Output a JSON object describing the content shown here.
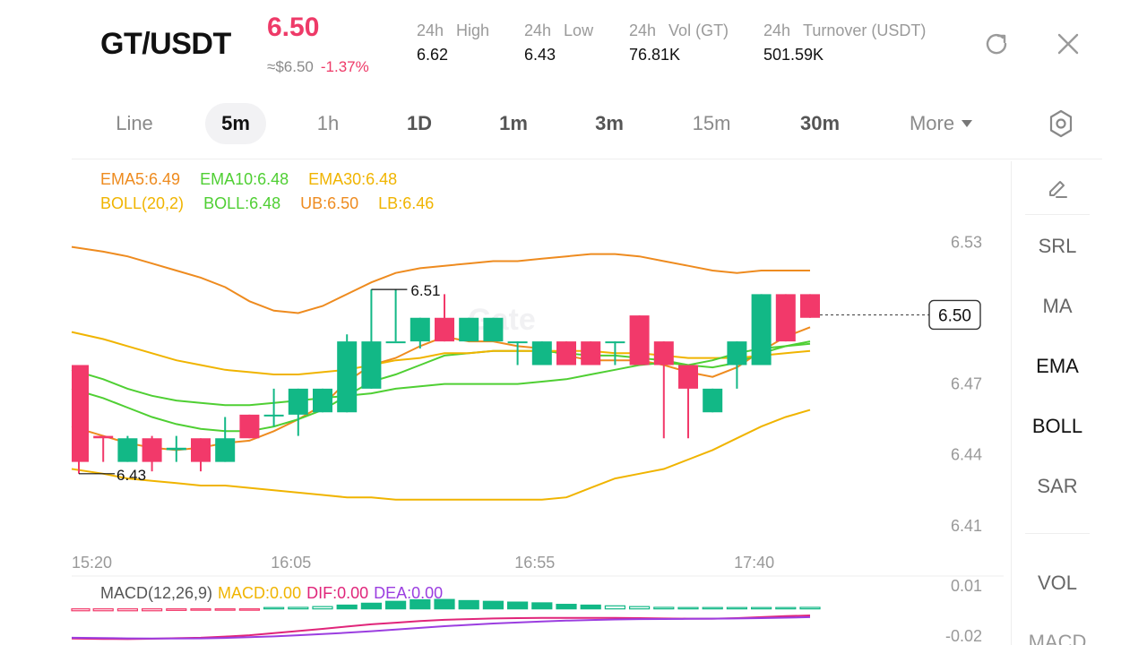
{
  "header": {
    "pair": "GT/USDT",
    "price": "6.50",
    "approx": "≈$6.50",
    "change": "-1.37%",
    "stats": [
      {
        "l1": "24h",
        "l2": "High",
        "value": "6.62"
      },
      {
        "l1": "24h",
        "l2": "Low",
        "value": "6.43"
      },
      {
        "l1": "24h",
        "l2": "Vol (GT)",
        "value": "76.81K"
      },
      {
        "l1": "24h",
        "l2": "Turnover (USDT)",
        "value": "501.59K"
      }
    ]
  },
  "tabs": [
    "Line",
    "5m",
    "1h",
    "1D",
    "1m",
    "3m",
    "15m",
    "30m",
    "More"
  ],
  "active_tab": "5m",
  "legend": {
    "ema5": "EMA5:6.49",
    "ema10": "EMA10:6.48",
    "ema30": "EMA30:6.48",
    "boll": "BOLL(20,2)",
    "boll_mid": "BOLL:6.48",
    "ub": "UB:6.50",
    "lb": "LB:6.46"
  },
  "side": {
    "srl": "SRL",
    "ma": "MA",
    "ema": "EMA",
    "boll": "BOLL",
    "sar": "SAR",
    "vol": "VOL",
    "macd": "MACD"
  },
  "macd_legend": {
    "params": "MACD(12,26,9)",
    "macd": "MACD:0.00",
    "dif": "DIF:0.00",
    "dea": "DEA:0.00"
  },
  "colors": {
    "up": "#12b886",
    "down": "#f2396a",
    "ema5": "#ee8b1f",
    "ema10": "#4fcf33",
    "ema30": "#f0b400",
    "dif": "#e0257a",
    "dea": "#9b3ee0"
  },
  "chart_data": {
    "type": "candlestick",
    "ylim": [
      6.405,
      6.54
    ],
    "y_ticks": [
      "6.53",
      "6.47",
      "6.44",
      "6.41"
    ],
    "x_ticks": [
      {
        "label": "15:20",
        "index": 0
      },
      {
        "label": "16:05",
        "index": 9
      },
      {
        "label": "16:55",
        "index": 19
      },
      {
        "label": "17:40",
        "index": 28
      }
    ],
    "last_price": "6.50",
    "high_label": "6.51",
    "low_label": "6.43",
    "candles": [
      {
        "o": 6.478,
        "h": 6.478,
        "l": 6.432,
        "c": 6.437
      },
      {
        "o": 6.448,
        "h": 6.448,
        "l": 6.437,
        "c": 6.447
      },
      {
        "o": 6.437,
        "h": 6.448,
        "l": 6.437,
        "c": 6.447
      },
      {
        "o": 6.447,
        "h": 6.448,
        "l": 6.433,
        "c": 6.437
      },
      {
        "o": 6.442,
        "h": 6.448,
        "l": 6.437,
        "c": 6.443
      },
      {
        "o": 6.447,
        "h": 6.447,
        "l": 6.433,
        "c": 6.437
      },
      {
        "o": 6.437,
        "h": 6.456,
        "l": 6.437,
        "c": 6.447
      },
      {
        "o": 6.457,
        "h": 6.457,
        "l": 6.447,
        "c": 6.447
      },
      {
        "o": 6.457,
        "h": 6.468,
        "l": 6.452,
        "c": 6.457
      },
      {
        "o": 6.457,
        "h": 6.468,
        "l": 6.448,
        "c": 6.468
      },
      {
        "o": 6.458,
        "h": 6.468,
        "l": 6.458,
        "c": 6.468
      },
      {
        "o": 6.458,
        "h": 6.491,
        "l": 6.458,
        "c": 6.488
      },
      {
        "o": 6.468,
        "h": 6.51,
        "l": 6.468,
        "c": 6.488
      },
      {
        "o": 6.488,
        "h": 6.51,
        "l": 6.488,
        "c": 6.488
      },
      {
        "o": 6.488,
        "h": 6.498,
        "l": 6.485,
        "c": 6.498
      },
      {
        "o": 6.498,
        "h": 6.508,
        "l": 6.488,
        "c": 6.488
      },
      {
        "o": 6.488,
        "h": 6.498,
        "l": 6.488,
        "c": 6.498
      },
      {
        "o": 6.488,
        "h": 6.498,
        "l": 6.488,
        "c": 6.498
      },
      {
        "o": 6.488,
        "h": 6.488,
        "l": 6.478,
        "c": 6.488
      },
      {
        "o": 6.478,
        "h": 6.488,
        "l": 6.478,
        "c": 6.488
      },
      {
        "o": 6.488,
        "h": 6.488,
        "l": 6.478,
        "c": 6.478
      },
      {
        "o": 6.488,
        "h": 6.488,
        "l": 6.478,
        "c": 6.478
      },
      {
        "o": 6.488,
        "h": 6.488,
        "l": 6.478,
        "c": 6.488
      },
      {
        "o": 6.499,
        "h": 6.499,
        "l": 6.478,
        "c": 6.478
      },
      {
        "o": 6.488,
        "h": 6.488,
        "l": 6.447,
        "c": 6.478
      },
      {
        "o": 6.478,
        "h": 6.478,
        "l": 6.447,
        "c": 6.468
      },
      {
        "o": 6.458,
        "h": 6.468,
        "l": 6.458,
        "c": 6.468
      },
      {
        "o": 6.478,
        "h": 6.488,
        "l": 6.468,
        "c": 6.488
      },
      {
        "o": 6.478,
        "h": 6.508,
        "l": 6.478,
        "c": 6.508
      },
      {
        "o": 6.508,
        "h": 6.508,
        "l": 6.488,
        "c": 6.488
      },
      {
        "o": 6.508,
        "h": 6.508,
        "l": 6.498,
        "c": 6.498
      }
    ],
    "series": [
      {
        "key": "ema5",
        "values": [
          6.452,
          6.448,
          6.445,
          6.443,
          6.442,
          6.443,
          6.445,
          6.446,
          6.45,
          6.455,
          6.461,
          6.471,
          6.478,
          6.481,
          6.486,
          6.49,
          6.488,
          6.488,
          6.486,
          6.485,
          6.482,
          6.48,
          6.48,
          6.48,
          6.478,
          6.475,
          6.473,
          6.477,
          6.484,
          6.49,
          6.494
        ]
      },
      {
        "key": "ema10",
        "values": [
          6.468,
          6.464,
          6.46,
          6.456,
          6.453,
          6.451,
          6.45,
          6.45,
          6.452,
          6.455,
          6.459,
          6.465,
          6.471,
          6.474,
          6.478,
          6.482,
          6.483,
          6.484,
          6.484,
          6.484,
          6.483,
          6.482,
          6.482,
          6.481,
          6.48,
          6.478,
          6.477,
          6.479,
          6.483,
          6.486,
          6.488
        ]
      },
      {
        "key": "ema30",
        "values": [
          6.492,
          6.489,
          6.486,
          6.483,
          6.48,
          6.478,
          6.476,
          6.475,
          6.474,
          6.474,
          6.475,
          6.476,
          6.478,
          6.48,
          6.481,
          6.483,
          6.483,
          6.484,
          6.484,
          6.484,
          6.484,
          6.484,
          6.483,
          6.483,
          6.482,
          6.481,
          6.481,
          6.481,
          6.482,
          6.483,
          6.484
        ]
      },
      {
        "key": "boll_mid",
        "values": [
          6.476,
          6.472,
          6.468,
          6.465,
          6.463,
          6.462,
          6.461,
          6.461,
          6.462,
          6.463,
          6.464,
          6.465,
          6.466,
          6.468,
          6.469,
          6.47,
          6.47,
          6.47,
          6.47,
          6.471,
          6.472,
          6.474,
          6.476,
          6.478,
          6.479,
          6.478,
          6.48,
          6.483,
          6.485,
          6.486,
          6.487
        ]
      },
      {
        "key": "ub",
        "values": [
          6.528,
          6.526,
          6.524,
          6.521,
          6.518,
          6.515,
          6.511,
          6.505,
          6.501,
          6.5,
          6.503,
          6.508,
          6.513,
          6.517,
          6.519,
          6.52,
          6.521,
          6.522,
          6.522,
          6.523,
          6.524,
          6.525,
          6.525,
          6.524,
          6.522,
          6.52,
          6.518,
          6.517,
          6.518,
          6.518,
          6.518
        ]
      },
      {
        "key": "lb",
        "values": [
          6.434,
          6.432,
          6.43,
          6.429,
          6.428,
          6.427,
          6.427,
          6.426,
          6.425,
          6.424,
          6.423,
          6.422,
          6.422,
          6.421,
          6.421,
          6.421,
          6.421,
          6.421,
          6.421,
          6.421,
          6.422,
          6.426,
          6.43,
          6.432,
          6.434,
          6.438,
          6.442,
          6.447,
          6.452,
          6.456,
          6.459
        ]
      }
    ],
    "macd": {
      "ylim": [
        -0.02,
        0.01
      ],
      "y_ticks": [
        "0.01",
        "-0.02"
      ],
      "hist": [
        -0.0005,
        -0.0005,
        -0.0005,
        -0.0005,
        -0.0004,
        -0.0003,
        -0.0002,
        -0.0001,
        0.0002,
        0.0004,
        0.0006,
        0.001,
        0.0015,
        0.002,
        0.0024,
        0.0025,
        0.0022,
        0.002,
        0.0018,
        0.0016,
        0.0012,
        0.001,
        0.0008,
        0.0006,
        0.0004,
        0.0002,
        0.0,
        0.0001,
        0.0002,
        0.0003,
        0.0004
      ],
      "dif": [
        -0.014,
        -0.0142,
        -0.0143,
        -0.0141,
        -0.0138,
        -0.0135,
        -0.0128,
        -0.012,
        -0.0108,
        -0.0095,
        -0.0082,
        -0.0068,
        -0.0055,
        -0.0045,
        -0.0035,
        -0.0028,
        -0.0024,
        -0.002,
        -0.0018,
        -0.0016,
        -0.0016,
        -0.0016,
        -0.0017,
        -0.0018,
        -0.002,
        -0.0021,
        -0.0021,
        -0.0018,
        -0.0012,
        -0.0006,
        -0.0002
      ],
      "dea": [
        -0.0135,
        -0.0137,
        -0.0139,
        -0.014,
        -0.014,
        -0.0139,
        -0.0136,
        -0.0132,
        -0.0127,
        -0.012,
        -0.0113,
        -0.0105,
        -0.0096,
        -0.0086,
        -0.0076,
        -0.0066,
        -0.0058,
        -0.005,
        -0.0044,
        -0.0038,
        -0.0033,
        -0.0029,
        -0.0026,
        -0.0024,
        -0.0023,
        -0.0022,
        -0.0021,
        -0.002,
        -0.0018,
        -0.0015,
        -0.0012
      ]
    }
  }
}
